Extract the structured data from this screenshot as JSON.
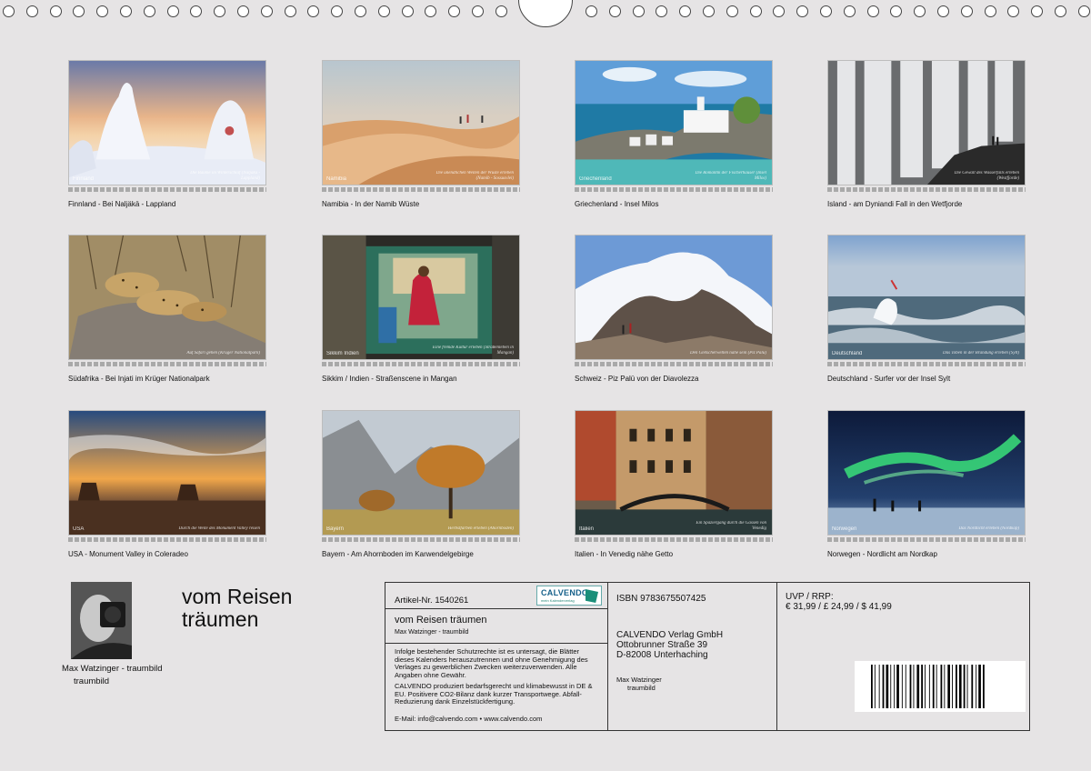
{
  "calendar": {
    "months": [
      {
        "caption": "Finnland - Bei Naljäkä - Lappland",
        "label": "Finnland",
        "quote": "Die Bäume im Winterschlaf (Naljäkä - Lappland)"
      },
      {
        "caption": "Namibia - In der Namib Wüste",
        "label": "Namibia",
        "quote": "Die unendlichen Weiten der Wüste erleben (Namib - Sossusvlei)"
      },
      {
        "caption": "Griechenland - Insel Milos",
        "label": "Griechenland",
        "quote": "Die Romantik der Fischerhäuser (Insel Milos)"
      },
      {
        "caption": "Island - am Dyniandi Fall in den  Wetfjorde",
        "label": "",
        "quote": "Die Gewalt des Wasserfalls erleben (Westfjorde)"
      },
      {
        "caption": "Südafrika - Bei Injati im Krüger Nationalpark",
        "label": "",
        "quote": "Auf Safari gehen (Krüger Nationalpark)"
      },
      {
        "caption": "Sikkim / Indien - Straßenscene in Mangan",
        "label": "Sikkim Indien",
        "quote": "Eine fremde Kultur erleben (Straßenleben in Mangan)"
      },
      {
        "caption": "Schweiz - Piz Palü von der Diavolezza",
        "label": "",
        "quote": "Den Gletscherwelten nahe sein (Piz Palü)"
      },
      {
        "caption": "Deutschland - Surfer vor der Insel Sylt",
        "label": "Deutschland",
        "quote": "Das Toben in der Brandung erleben (Sylt)"
      },
      {
        "caption": "USA - Monument Valley in Coleradeo",
        "label": "USA",
        "quote": "Durch die Weite des Monument Valley reisen"
      },
      {
        "caption": "Bayern - Am Ahornboden im Karwendelgebirge",
        "label": "Bayern",
        "quote": "Herbstfarben erleben (Ahornboden)"
      },
      {
        "caption": "Italien - In Venedig nähe Getto",
        "label": "Italien",
        "quote": "Ein Spaziergang durch die Gassen von Venedig"
      },
      {
        "caption": "Norwegen - Nordlicht am Nordkap",
        "label": "Norwegen",
        "quote": "Das Nordlicht erleben (Nordkap)"
      }
    ]
  },
  "author": {
    "name": "Max Watzinger - traumbild",
    "sub": "traumbild"
  },
  "main_title": "vom Reisen träumen",
  "info": {
    "article_nr": "Artikel-Nr. 1540261",
    "brand": "CALVENDO",
    "brand_sub": "mein Kalenderverlag",
    "title": "vom Reisen träumen",
    "subtitle": "Max Watzinger - traumbild",
    "legal_1": "Infolge bestehender Schutzrechte ist es untersagt, die Blätter dieses Kalenders herauszutrennen und ohne Genehmigung des Verlages zu gewerblichen Zwecken weiterzuverwenden. Alle Angaben ohne Gewähr.",
    "legal_2": "CALVENDO produziert bedarfsgerecht und klimabewusst in DE & EU. Positivere CO2-Bilanz dank kurzer Transportwege. Abfall-Reduzierung dank Einzelstückfertigung.",
    "email": "E-Mail: info@calvendo.com • www.calvendo.com",
    "isbn": "ISBN 9783675507425",
    "publisher_1": "CALVENDO Verlag GmbH",
    "publisher_2": "Ottobrunner Straße 39",
    "publisher_3": "D-82008 Unterhaching",
    "pub_author_1": "Max Watzinger",
    "pub_author_2": "traumbild",
    "price_label": "UVP / RRP:",
    "price": "€ 31,99 / £ 24,99 / $ 41,99"
  },
  "colors": {
    "background": "#e6e4e5",
    "border": "#333333",
    "brand": "#16608a"
  }
}
